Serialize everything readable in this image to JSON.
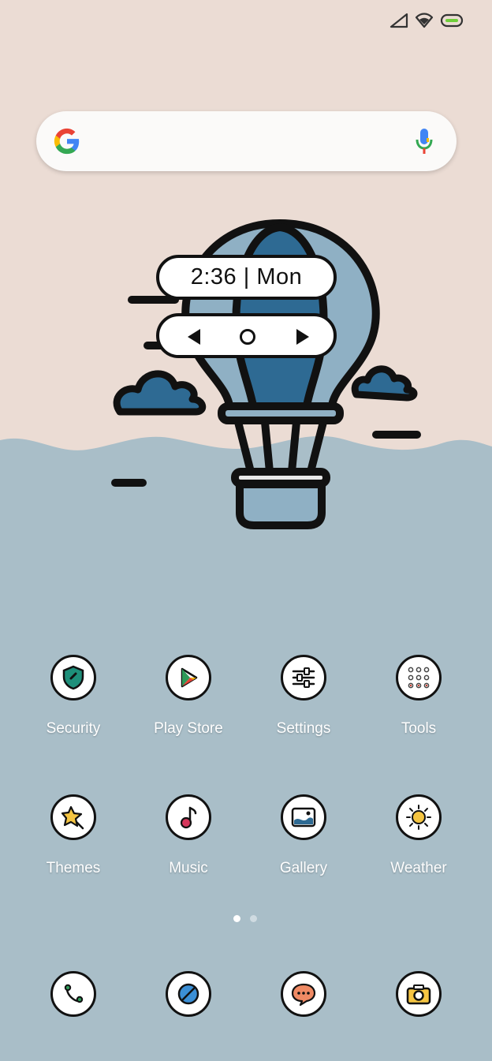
{
  "widget": {
    "clock_text": "2:36 | Mon"
  },
  "search": {
    "mic_icon": "mic-icon",
    "google_icon": "google-g-icon"
  },
  "apps": [
    {
      "label": "Security",
      "icon": "shield-icon"
    },
    {
      "label": "Play Store",
      "icon": "play-store-icon"
    },
    {
      "label": "Settings",
      "icon": "sliders-icon"
    },
    {
      "label": "Tools",
      "icon": "grid-dots-icon"
    },
    {
      "label": "Themes",
      "icon": "star-icon"
    },
    {
      "label": "Music",
      "icon": "music-note-icon"
    },
    {
      "label": "Gallery",
      "icon": "image-icon"
    },
    {
      "label": "Weather",
      "icon": "sun-icon"
    }
  ],
  "dock": [
    {
      "icon": "phone-icon"
    },
    {
      "icon": "browser-icon"
    },
    {
      "icon": "message-icon"
    },
    {
      "icon": "camera-icon"
    }
  ],
  "pages": {
    "count": 2,
    "active": 1
  },
  "colors": {
    "sky": "#ebdcd4",
    "water": "#a9bec8",
    "balloon_blue": "#2e6a93",
    "balloon_light": "#8fb0c4",
    "outline": "#111111"
  }
}
